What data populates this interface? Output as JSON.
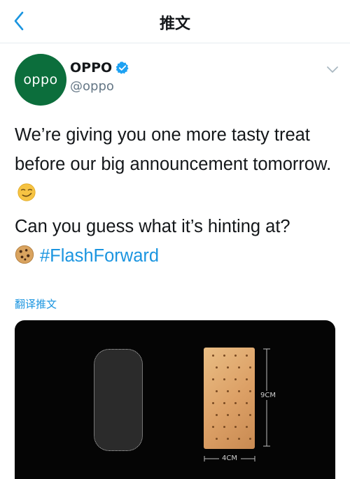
{
  "nav": {
    "title": "推文",
    "back_icon": "chevron-left-icon"
  },
  "author": {
    "avatar_text": "oppo",
    "avatar_color": "#0c6e3c",
    "name": "OPPO",
    "handle": "@oppo",
    "verified": true
  },
  "tweet": {
    "line1": "We’re giving you one more tasty treat before our big announcement tomorrow.",
    "line2": "Can you guess what it’s hinting at?",
    "hashtag": "#FlashForward",
    "emoji_1": "smirking-face",
    "emoji_2": "cookie"
  },
  "translate_label": "翻译推文",
  "media": {
    "height_label": "9CM",
    "width_label": "4CM"
  },
  "colors": {
    "link": "#1b95e0",
    "text": "#14171a",
    "secondary": "#657786"
  }
}
